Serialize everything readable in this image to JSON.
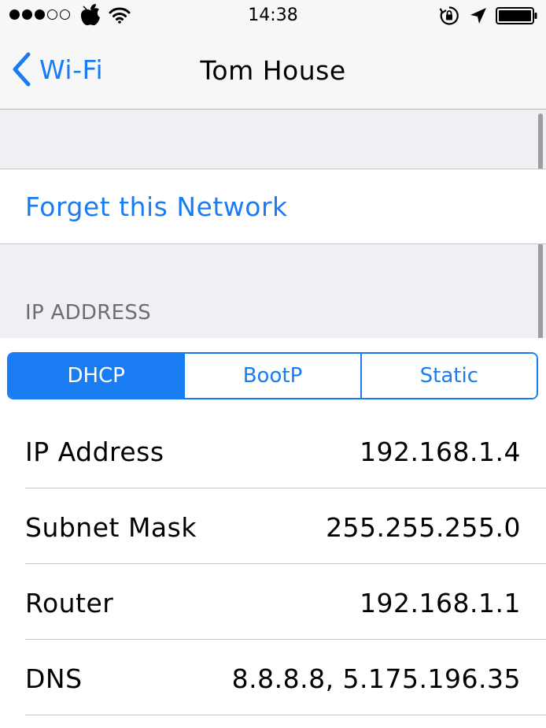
{
  "status_bar": {
    "signal_bars_full": 3,
    "signal_bars_total": 5,
    "carrier_icon": "apple-logo-icon",
    "wifi_icon": "wifi-icon",
    "time": "14:38",
    "rotation_lock_icon": "rotation-lock-icon",
    "location_icon": "location-arrow-icon",
    "battery_icon": "battery-icon",
    "battery_level": 1.0
  },
  "nav": {
    "back_label": "Wi-Fi",
    "title": "Tom House"
  },
  "actions": {
    "forget_label": "Forget this Network"
  },
  "ip_section": {
    "header": "IP ADDRESS",
    "modes": [
      "DHCP",
      "BootP",
      "Static"
    ],
    "selected_mode": "DHCP",
    "rows": [
      {
        "label": "IP Address",
        "value": "192.168.1.4"
      },
      {
        "label": "Subnet Mask",
        "value": "255.255.255.0"
      },
      {
        "label": "Router",
        "value": "192.168.1.1"
      },
      {
        "label": "DNS",
        "value": "8.8.8.8, 5.175.196.35"
      }
    ]
  },
  "colors": {
    "accent": "#1a7cf2",
    "background": "#efeff4",
    "separator": "#c8c7cc",
    "header_text": "#6d6d72"
  }
}
